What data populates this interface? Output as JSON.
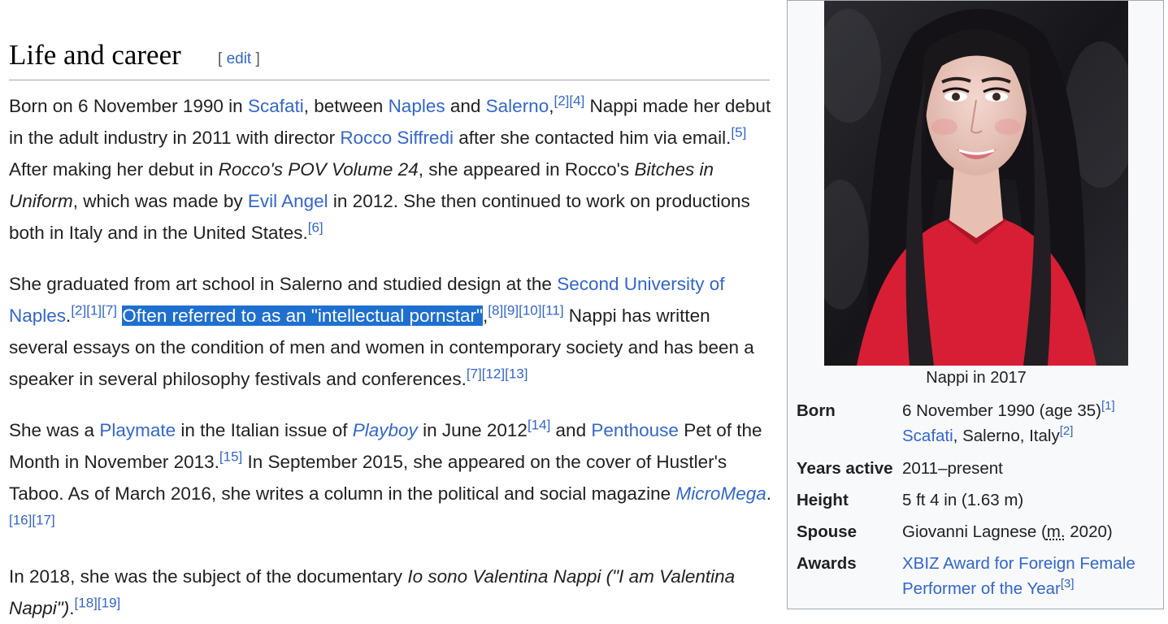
{
  "section": {
    "title": "Life and career",
    "edit_open": "[",
    "edit_label": "edit",
    "edit_close": "]"
  },
  "p1": {
    "t1": "Born on 6 November 1990 in ",
    "l_scafati": "Scafati",
    "t2": ", between ",
    "l_naples": "Naples",
    "t3": " and ",
    "l_salerno": "Salerno",
    "t4": ",",
    "r2": "[2]",
    "r4": "[4]",
    "t5": " Nappi made her debut in the adult industry in 2011 with director ",
    "l_rocco": "Rocco Siffredi",
    "t6": " after she contacted him via email.",
    "r5": "[5]",
    "t7": " After making her debut in ",
    "i1": "Rocco's POV Volume 24",
    "t8": ", she appeared in Rocco's ",
    "i2": "Bitches in Uniform",
    "t9": ", which was made by ",
    "l_evil": "Evil Angel",
    "t10": " in 2012. She then continued to work on productions both in Italy and in the United States.",
    "r6": "[6]"
  },
  "p2": {
    "t1": "She graduated from art school in Salerno and studied design at the ",
    "l_univ": "Second University of Naples",
    "t2": ".",
    "r2": "[2]",
    "r1": "[1]",
    "r7": "[7]",
    "t3": " ",
    "sel": "Often referred to as an \"intellectual pornstar\"",
    "t4": ",",
    "r8": "[8]",
    "r9": "[9]",
    "r10": "[10]",
    "r11": "[11]",
    "t5": " Nappi has written several essays on the condition of men and women in contemporary society and has been a speaker in several philosophy festivals and conferences.",
    "r7b": "[7]",
    "r12": "[12]",
    "r13": "[13]"
  },
  "p3": {
    "t1": "She was a ",
    "l_playmate": "Playmate",
    "t2": " in the Italian issue of ",
    "l_playboy": "Playboy",
    "t3": " in June 2012",
    "r14": "[14]",
    "t4": " and ",
    "l_penthouse": "Penthouse",
    "t5": " Pet of the Month in November 2013.",
    "r15": "[15]",
    "t6": " In September 2015, she appeared on the cover of Hustler's Taboo. As of March 2016, she writes a column in the political and social magazine ",
    "l_micromega": "MicroMega",
    "t7": ".",
    "r16": "[16]",
    "r17": "[17]"
  },
  "p4": {
    "t1": "In 2018, she was the subject of the documentary ",
    "i1": "Io sono Valentina Nappi (\"I am Valentina Nappi\")",
    "t2": ".",
    "r18": "[18]",
    "r19": "[19]"
  },
  "infobox": {
    "caption": "Nappi in 2017",
    "born_label": "Born",
    "born_date": "6 November 1990 (age 35)",
    "born_ref1": "[1]",
    "born_place_link": "Scafati",
    "born_place_rest": ", Salerno, Italy",
    "born_ref2": "[2]",
    "years_label": "Years active",
    "years_value": "2011–present",
    "height_label": "Height",
    "height_value": "5 ft 4 in (1.63 m)",
    "spouse_label": "Spouse",
    "spouse_name": "Giovanni Lagnese (",
    "spouse_abbr": "m.",
    "spouse_year": " 2020)",
    "awards_label": "Awards",
    "awards_link": "XBIZ Award for Foreign Female Performer of the Year",
    "awards_ref": "[3]"
  },
  "colors": {
    "link": "#3366cc",
    "text": "#202122",
    "selection": "#1f6fcf",
    "infobox_bg": "#f8f9fa",
    "photo_bg": "#1e1e22",
    "dress": "#d81e34"
  },
  "icons": {
    "photo": "portrait-photo"
  }
}
